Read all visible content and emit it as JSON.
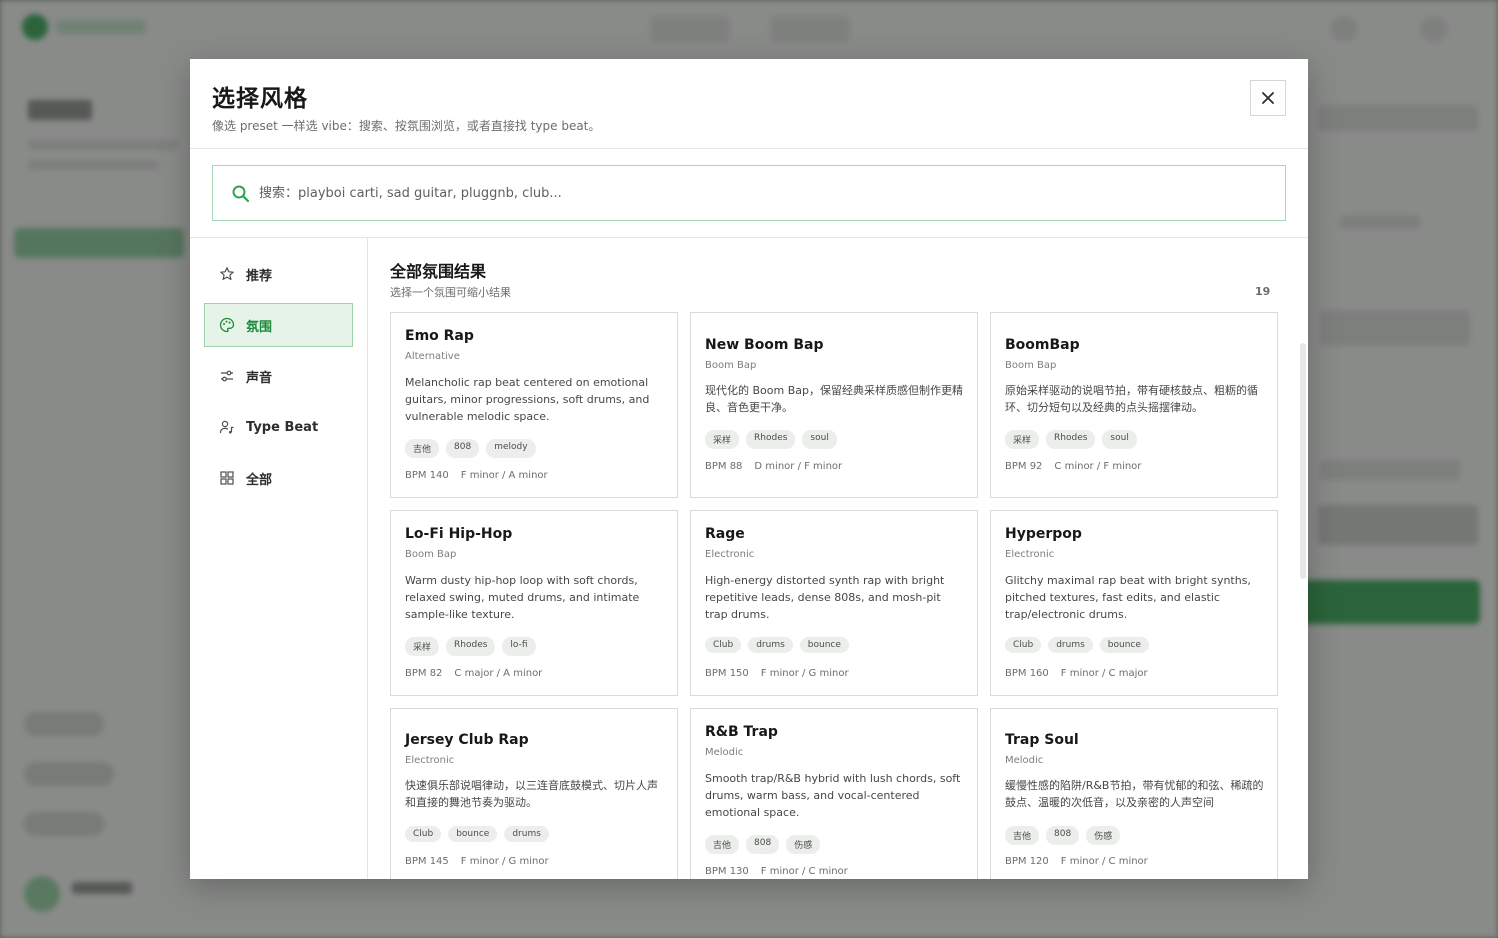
{
  "modal": {
    "title": "选择风格",
    "subtitle": "像选 preset 一样选 vibe：搜索、按氛围浏览，或者直接找 type beat。",
    "close_icon": "close-icon"
  },
  "search": {
    "placeholder": "搜索：playboi carti, sad guitar, pluggnb, club...",
    "value": ""
  },
  "sidebar": {
    "items": [
      {
        "label": "推荐",
        "icon": "star-icon",
        "active": false
      },
      {
        "label": "氛围",
        "icon": "palette-icon",
        "active": true
      },
      {
        "label": "声音",
        "icon": "sliders-icon",
        "active": false
      },
      {
        "label": "Type Beat",
        "icon": "user-music-icon",
        "active": false
      },
      {
        "label": "全部",
        "icon": "grid-icon",
        "active": false
      }
    ]
  },
  "section": {
    "title": "全部氛围结果",
    "subtitle": "选择一个氛围可缩小结果",
    "count": "19"
  },
  "cards": [
    {
      "title": "Emo Rap",
      "genre": "Alternative",
      "desc": "Melancholic rap beat centered on emotional guitars, minor progressions, soft drums, and vulnerable melodic space.",
      "tags": [
        "吉他",
        "808",
        "melody"
      ],
      "bpm": "BPM 140",
      "key": "F minor / A minor"
    },
    {
      "title": "New Boom Bap",
      "genre": "Boom Bap",
      "desc": "现代化的 Boom Bap，保留经典采样质感但制作更精良、音色更干净。",
      "tags": [
        "采样",
        "Rhodes",
        "soul"
      ],
      "bpm": "BPM 88",
      "key": "D minor / F minor"
    },
    {
      "title": "BoomBap",
      "genre": "Boom Bap",
      "desc": "原始采样驱动的说唱节拍，带有硬核鼓点、粗粝的循环、切分短句以及经典的点头摇摆律动。",
      "tags": [
        "采样",
        "Rhodes",
        "soul"
      ],
      "bpm": "BPM 92",
      "key": "C minor / F minor"
    },
    {
      "title": "Lo-Fi Hip-Hop",
      "genre": "Boom Bap",
      "desc": "Warm dusty hip-hop loop with soft chords, relaxed swing, muted drums, and intimate sample-like texture.",
      "tags": [
        "采样",
        "Rhodes",
        "lo-fi"
      ],
      "bpm": "BPM 82",
      "key": "C major / A minor"
    },
    {
      "title": "Rage",
      "genre": "Electronic",
      "desc": "High-energy distorted synth rap with bright repetitive leads, dense 808s, and mosh-pit trap drums.",
      "tags": [
        "Club",
        "drums",
        "bounce"
      ],
      "bpm": "BPM 150",
      "key": "F minor / G minor"
    },
    {
      "title": "Hyperpop",
      "genre": "Electronic",
      "desc": "Glitchy maximal rap beat with bright synths, pitched textures, fast edits, and elastic trap/electronic drums.",
      "tags": [
        "Club",
        "drums",
        "bounce"
      ],
      "bpm": "BPM 160",
      "key": "F minor / C major"
    },
    {
      "title": "Jersey Club Rap",
      "genre": "Electronic",
      "desc": "快速俱乐部说唱律动，以三连音底鼓模式、切片人声和直接的舞池节奏为驱动。",
      "tags": [
        "Club",
        "bounce",
        "drums"
      ],
      "bpm": "BPM 145",
      "key": "F minor / G minor"
    },
    {
      "title": "R&B Trap",
      "genre": "Melodic",
      "desc": "Smooth trap/R&B hybrid with lush chords, soft drums, warm bass, and vocal-centered emotional space.",
      "tags": [
        "吉他",
        "808",
        "伤感"
      ],
      "bpm": "BPM 130",
      "key": "F minor / C minor"
    },
    {
      "title": "Trap Soul",
      "genre": "Melodic",
      "desc": "缓慢性感的陷阱/R&B节拍，带有忧郁的和弦、稀疏的鼓点、温暖的次低音，以及亲密的人声空间",
      "tags": [
        "吉他",
        "808",
        "伤感"
      ],
      "bpm": "BPM 120",
      "key": "F minor / C minor"
    }
  ],
  "colors": {
    "accent": "#2ea44f",
    "active_bg": "#e6f3e9"
  }
}
